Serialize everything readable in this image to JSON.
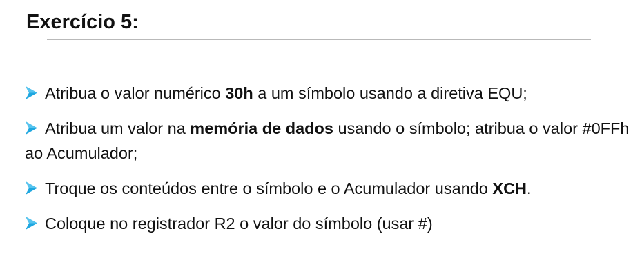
{
  "slide": {
    "title": "Exercício 5:",
    "accent_color": "#1fa7e0",
    "bullet_icon": "arrow-bullet-icon"
  },
  "bullets": [
    {
      "pre": "Atribua o valor numérico ",
      "bold": "30h",
      "post": " a um símbolo usando a diretiva EQU;"
    },
    {
      "pre": "Atribua um valor na ",
      "bold": "memória de dados",
      "post": " usando o símbolo; atribua o valor #0FFh ao Acumulador;"
    },
    {
      "pre": "Troque os conteúdos entre o símbolo e o Acumulador usando ",
      "bold": "XCH",
      "post": "."
    },
    {
      "text": "Coloque no registrador R2 o valor do símbolo (usar #)"
    }
  ]
}
